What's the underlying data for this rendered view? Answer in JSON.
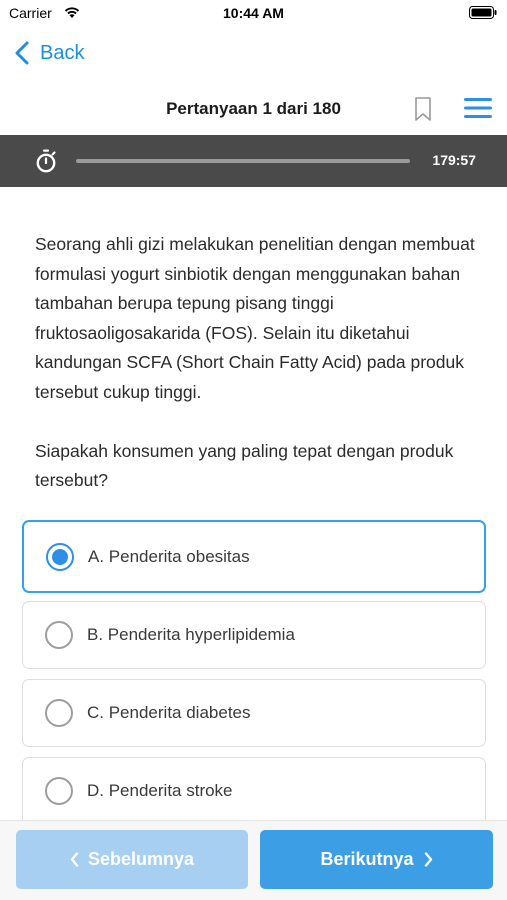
{
  "status_bar": {
    "carrier": "Carrier",
    "time": "10:44 AM"
  },
  "nav": {
    "back_label": "Back"
  },
  "header": {
    "counter": "Pertanyaan 1 dari 180"
  },
  "timer": {
    "remaining": "179:57",
    "progress_fraction": 0.0
  },
  "question": {
    "paragraphs": [
      "Seorang ahli gizi melakukan penelitian dengan membuat formulasi yogurt sinbiotik dengan menggunakan bahan tambahan berupa tepung pisang tinggi fruktosaoligosakarida (FOS). Selain itu diketahui kandungan SCFA (Short Chain Fatty Acid) pada produk tersebut cukup tinggi.",
      "Siapakah konsumen yang paling tepat dengan produk tersebut?"
    ]
  },
  "options": [
    {
      "label": "A. Penderita obesitas",
      "selected": true
    },
    {
      "label": "B. Penderita hyperlipidemia",
      "selected": false
    },
    {
      "label": "C. Penderita diabetes",
      "selected": false
    },
    {
      "label": "D. Penderita stroke",
      "selected": false
    }
  ],
  "footer": {
    "prev_label": "Sebelumnya",
    "next_label": "Berikutnya"
  },
  "colors": {
    "accent": "#2e8fe4",
    "timer_bg": "#4a4a4a",
    "prev_btn": "#a6cff1",
    "next_btn": "#3c9fe6"
  }
}
